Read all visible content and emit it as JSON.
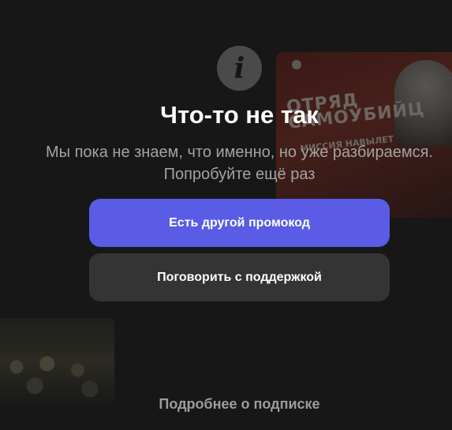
{
  "poster_right": {
    "title": "Отряд самоубийц",
    "subtitle": "Миссия навылет"
  },
  "info_icon": {
    "glyph": "i",
    "name": "info-icon"
  },
  "error": {
    "title": "Что-то не так",
    "message_line1": "Мы пока не знаем, что именно, но уже разбираемся.",
    "message_line2": "Попробуйте ещё раз"
  },
  "actions": {
    "promo_label": "Есть другой промокод",
    "support_label": "Поговорить с поддержкой"
  },
  "footer": {
    "more_label": "Подробнее о подписке",
    "chevron_glyph": "⌄"
  },
  "colors": {
    "background": "#171717",
    "primary_button": "#5a5ce6",
    "secondary_button": "#343434",
    "muted_text": "#a3a3a3"
  }
}
